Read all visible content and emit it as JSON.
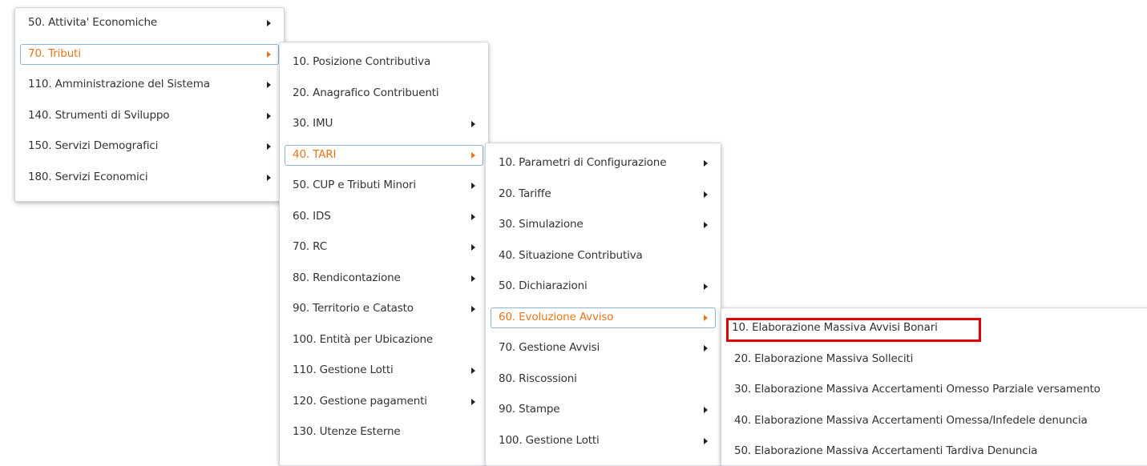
{
  "accent_color": "#e8751a",
  "highlight_color": "#e00000",
  "menus": {
    "main": {
      "items": [
        {
          "label": "50. Attivita' Economiche",
          "submenu": true
        },
        {
          "label": "70. Tributi",
          "submenu": true,
          "active": true
        },
        {
          "label": "110. Amministrazione del Sistema",
          "submenu": true
        },
        {
          "label": "140. Strumenti di Sviluppo",
          "submenu": true
        },
        {
          "label": "150. Servizi Demografici",
          "submenu": true
        },
        {
          "label": "180. Servizi Economici",
          "submenu": true
        }
      ]
    },
    "tributi": {
      "items": [
        {
          "label": "10. Posizione Contributiva",
          "submenu": false
        },
        {
          "label": "20. Anagrafico Contribuenti",
          "submenu": false
        },
        {
          "label": "30. IMU",
          "submenu": true
        },
        {
          "label": "40. TARI",
          "submenu": true,
          "active": true
        },
        {
          "label": "50. CUP e Tributi Minori",
          "submenu": true
        },
        {
          "label": "60. IDS",
          "submenu": true
        },
        {
          "label": "70. RC",
          "submenu": true
        },
        {
          "label": "80. Rendicontazione",
          "submenu": true
        },
        {
          "label": "90. Territorio e Catasto",
          "submenu": true
        },
        {
          "label": "100. Entità per Ubicazione",
          "submenu": false
        },
        {
          "label": "110. Gestione Lotti",
          "submenu": true
        },
        {
          "label": "120. Gestione pagamenti",
          "submenu": true
        },
        {
          "label": "130. Utenze Esterne",
          "submenu": false
        }
      ]
    },
    "tari": {
      "items": [
        {
          "label": "10. Parametri di Configurazione",
          "submenu": true
        },
        {
          "label": "20. Tariffe",
          "submenu": true
        },
        {
          "label": "30. Simulazione",
          "submenu": true
        },
        {
          "label": "40. Situazione Contributiva",
          "submenu": false
        },
        {
          "label": "50. Dichiarazioni",
          "submenu": true
        },
        {
          "label": "60. Evoluzione Avviso",
          "submenu": true,
          "active": true
        },
        {
          "label": "70. Gestione Avvisi",
          "submenu": true
        },
        {
          "label": "80. Riscossioni",
          "submenu": false
        },
        {
          "label": "90. Stampe",
          "submenu": true
        },
        {
          "label": "100. Gestione Lotti",
          "submenu": true
        }
      ]
    },
    "evoluzione_avviso": {
      "items": [
        {
          "label": "10. Elaborazione Massiva Avvisi Bonari",
          "submenu": false,
          "highlighted": true
        },
        {
          "label": "20. Elaborazione Massiva Solleciti",
          "submenu": false
        },
        {
          "label": "30. Elaborazione Massiva Accertamenti Omesso Parziale versamento",
          "submenu": false
        },
        {
          "label": "40. Elaborazione Massiva Accertamenti Omessa/Infedele denuncia",
          "submenu": false
        },
        {
          "label": "50. Elaborazione Massiva Accertamenti Tardiva Denuncia",
          "submenu": false
        }
      ]
    }
  }
}
